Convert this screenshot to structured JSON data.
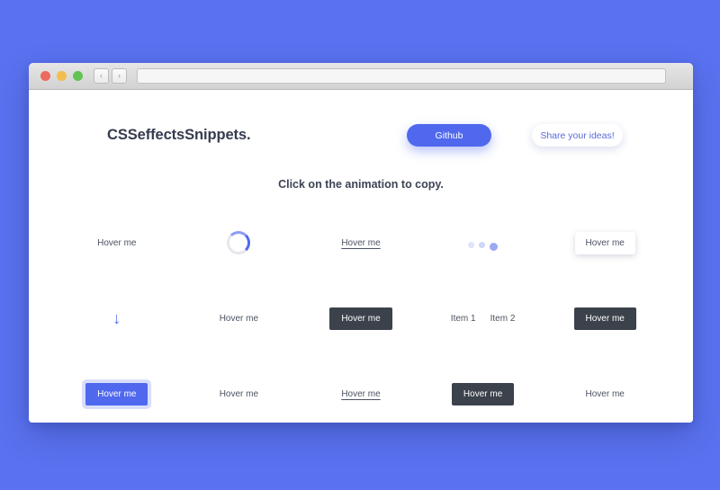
{
  "background_color": "#5a72f0",
  "browser": {
    "traffic_lights": [
      "close",
      "minimize",
      "maximize"
    ],
    "nav_back_icon": "‹",
    "nav_forward_icon": "›",
    "url_value": "",
    "url_placeholder": ""
  },
  "app": {
    "title": "CSSeffectsSnippets.",
    "github_label": "Github",
    "share_label": "Share your ideas!",
    "subtitle": "Click on the animation to copy.",
    "accent_color": "#4f68ee",
    "dark_color": "#3b424c",
    "text_color": "#4c5262"
  },
  "grid": {
    "rows": [
      {
        "cells": [
          {
            "name": "hover-text-plain-1",
            "type": "text-plain",
            "label": "Hover me"
          },
          {
            "name": "spinner-ring",
            "type": "spinner",
            "label": ""
          },
          {
            "name": "hover-link-underline-1",
            "type": "text-underline",
            "label": "Hover me"
          },
          {
            "name": "dots-loader",
            "type": "dots",
            "label": ""
          },
          {
            "name": "hover-card-white-1",
            "type": "card-white",
            "label": "Hover me"
          }
        ]
      },
      {
        "cells": [
          {
            "name": "arrow-down-icon",
            "type": "arrow-down",
            "label": "↓"
          },
          {
            "name": "hover-text-plain-2",
            "type": "text-plain",
            "label": "Hover me"
          },
          {
            "name": "hover-button-dark-1",
            "type": "button-dark",
            "label": "Hover me"
          },
          {
            "name": "menu-two-items",
            "type": "menu",
            "label": "",
            "items": [
              "Item 1",
              "Item 2"
            ]
          },
          {
            "name": "hover-button-dark-2",
            "type": "button-dark",
            "label": "Hover me"
          }
        ]
      },
      {
        "cells": [
          {
            "name": "hover-button-blue-1",
            "type": "button-blue",
            "label": "Hover me"
          },
          {
            "name": "hover-text-plain-3",
            "type": "text-plain",
            "label": "Hover me"
          },
          {
            "name": "hover-link-underline-2",
            "type": "text-underline",
            "label": "Hover me"
          },
          {
            "name": "hover-button-dark-3",
            "type": "button-dark",
            "label": "Hover me"
          },
          {
            "name": "hover-text-plain-4",
            "type": "text-plain",
            "label": "Hover me"
          }
        ]
      }
    ]
  }
}
